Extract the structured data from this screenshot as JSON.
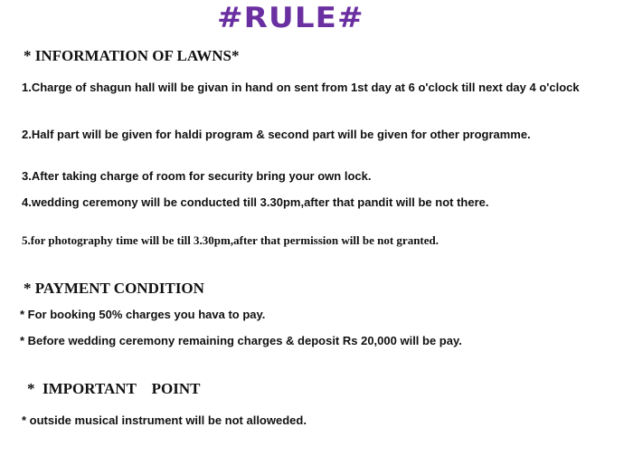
{
  "title": "#RULE#",
  "sections": {
    "lawns": {
      "heading": "* INFORMATION OF LAWNS*",
      "items": [
        "1.Charge of shagun hall will be givan in hand on sent from 1st day at 6 o'clock till next day 4 o'clock",
        "2.Half part will be given for haldi program & second part will be given for other programme.",
        "3.After taking charge of room for security bring your own lock.",
        "4.wedding ceremony will be conducted till 3.30pm,after that pandit will be not there.",
        "5.for photography time will be till 3.30pm,after that permission will be not granted."
      ]
    },
    "payment": {
      "heading": "* PAYMENT CONDITION",
      "items": [
        "* For booking 50% charges you hava to pay.",
        "* Before wedding ceremony remaining charges & deposit Rs 20,000 will be pay."
      ]
    },
    "important": {
      "heading": "*  IMPORTANT    POINT",
      "items": [
        "* outside musical instrument will be not alloweded."
      ]
    }
  },
  "colors": {
    "title": "#6a2fa0",
    "text": "#111111",
    "background": "#ffffff"
  }
}
